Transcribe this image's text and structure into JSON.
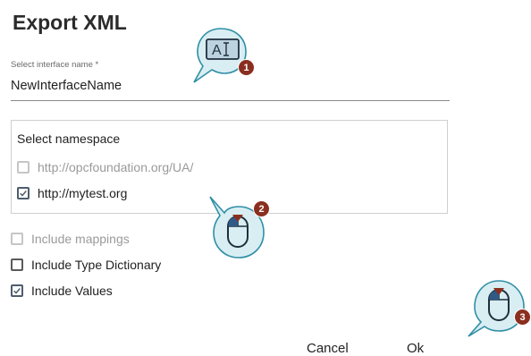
{
  "dialog": {
    "title": "Export XML",
    "interface_field": {
      "label": "Select interface name *",
      "value": "NewInterfaceName"
    },
    "namespace": {
      "title": "Select namespace",
      "items": [
        {
          "label": "http://opcfoundation.org/UA/",
          "checked": false,
          "disabled": true
        },
        {
          "label": "http://mytest.org",
          "checked": true,
          "disabled": false
        }
      ]
    },
    "options": [
      {
        "label": "Include mappings",
        "checked": false,
        "disabled": true
      },
      {
        "label": "Include Type Dictionary",
        "checked": false,
        "disabled": false
      },
      {
        "label": "Include Values",
        "checked": true,
        "disabled": false
      }
    ],
    "buttons": {
      "cancel": "Cancel",
      "ok": "Ok"
    }
  },
  "callouts": [
    {
      "step": "1",
      "icon": "text-input-icon"
    },
    {
      "step": "2",
      "icon": "mouse-left-click-icon"
    },
    {
      "step": "3",
      "icon": "mouse-left-click-icon"
    }
  ],
  "colors": {
    "callout_fill": "#d9eef2",
    "callout_stroke": "#2f8fa6",
    "badge": "#8a2f1f",
    "check": "#4e5d6e"
  }
}
